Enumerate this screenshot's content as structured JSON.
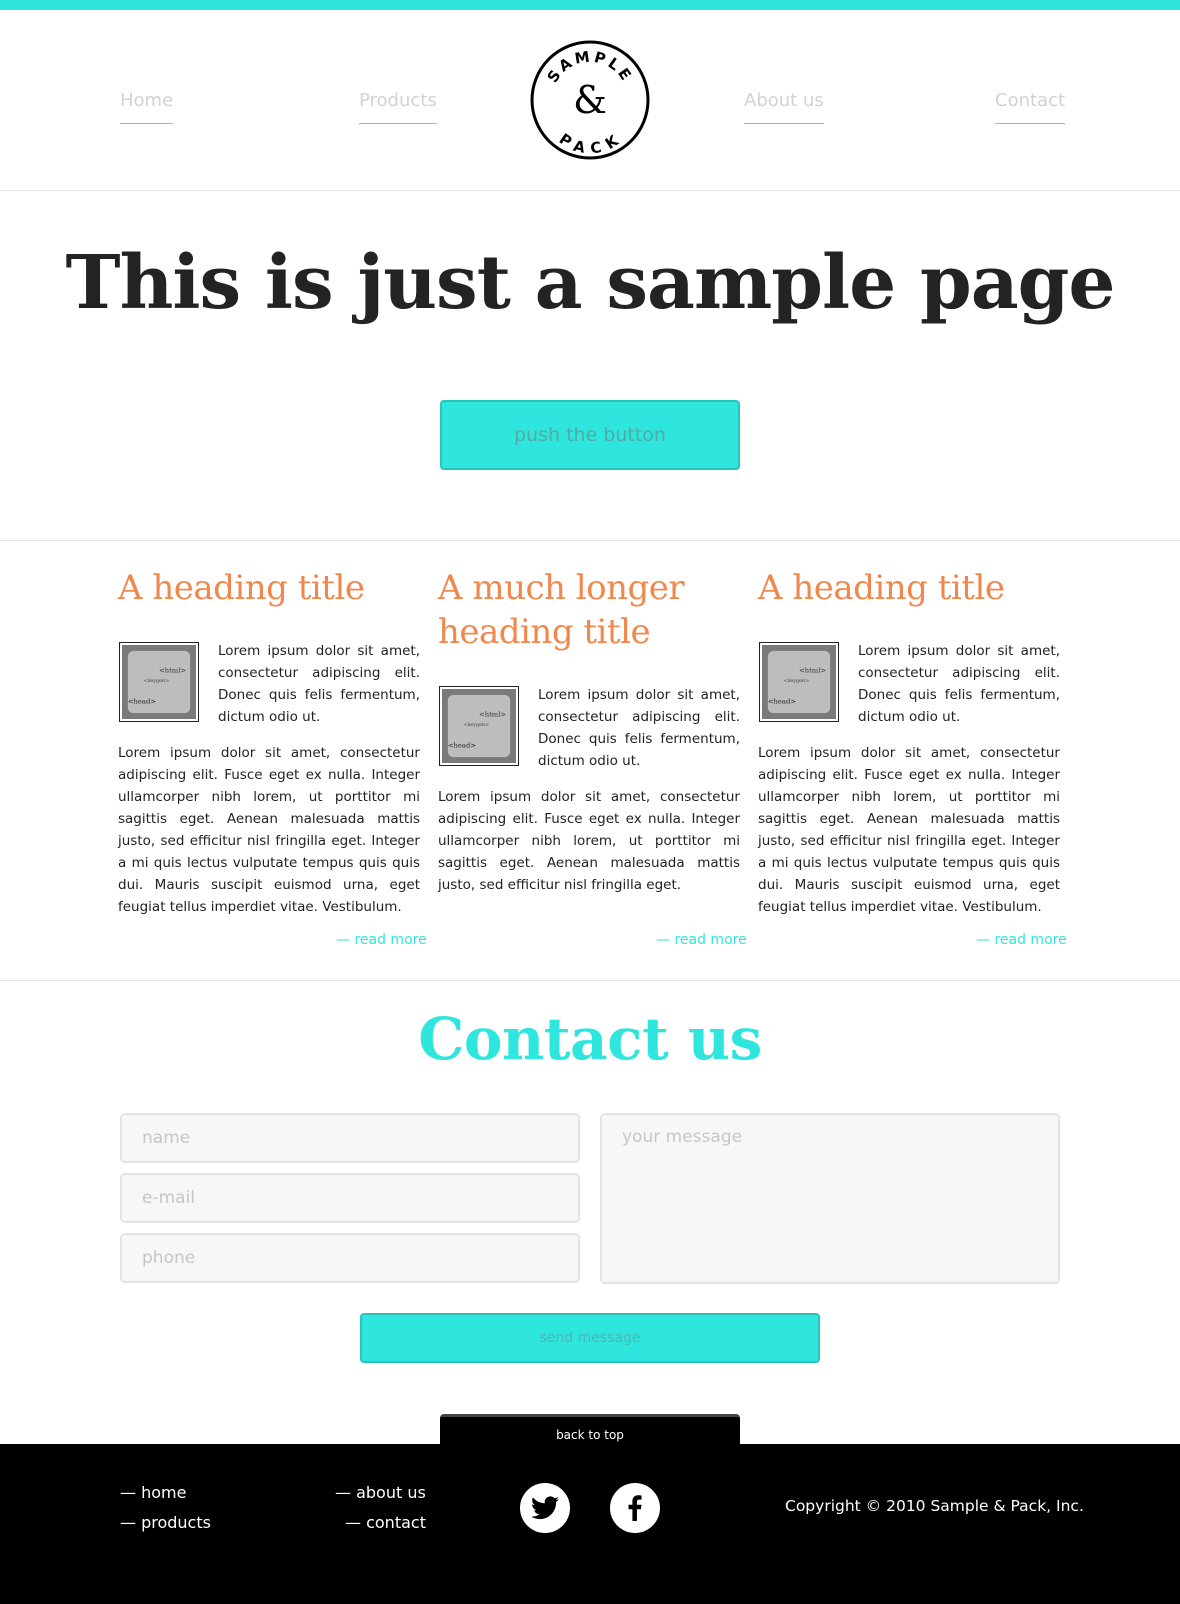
{
  "colors": {
    "accent": "#2ee6dd",
    "heading": "#f0884d",
    "footer": "#000000"
  },
  "nav": {
    "home": "Home",
    "products": "Products",
    "about": "About us",
    "contact": "Contact"
  },
  "logo": {
    "top": "SAMPLE",
    "middle": "&",
    "bottom": "PACK"
  },
  "hero": {
    "title": "This is just a sample page",
    "button": "push the button"
  },
  "columns": [
    {
      "heading": "A heading title",
      "intro": "Lorem ipsum dolor sit amet, consectetur adipiscing elit. Donec quis felis fermentum, dictum odio ut.",
      "body": "Lorem ipsum dolor sit amet, consectetur adip­iscing elit. Fusce eget ex nulla. Integer ullam­corper nibh lorem, ut porttitor mi sagittis eget. Aenean malesuada mattis justo, sed efficitur nisl fringilla eget. Integer a mi quis lectus vul­putate tempus quis quis dui. Mauris suscipit euismod urna, eget feugiat tellus imperdiet vitae. Vestibulum.",
      "read_more": "— read more"
    },
    {
      "heading": "A much longer heading title",
      "intro": "Lorem ipsum dolor sit amet, consectetur adipiscing elit. Donec quis felis fermentum, dictum odio ut.",
      "body": "Lorem ipsum dolor sit amet, consectetur adip­iscing elit. Fusce eget ex nulla. Integer ullam­corper nibh lorem, ut porttitor mi sagittis eget. Aenean malesuada mattis justo, sed efficitur nisl fringilla eget.",
      "read_more": "— read more"
    },
    {
      "heading": "A heading title",
      "intro": "Lorem ipsum dolor sit amet, consectetur adipiscing elit. Donec quis felis fermentum, dictum odio ut.",
      "body": "Lorem ipsum dolor sit amet, consectetur adip­iscing elit. Fusce eget ex nulla. Integer ullam­corper nibh lorem, ut porttitor mi sagittis eget. Aenean malesuada mattis justo, sed efficitur nisl fringilla eget. Integer a mi quis lectus vul­putate tempus quis quis dui. Mauris suscipit euismod urna, eget feugiat tellus imperdiet vitae. Vestibulum.",
      "read_more": "— read more"
    }
  ],
  "contact": {
    "title": "Contact us",
    "name_placeholder": "name",
    "email_placeholder": "e-mail",
    "phone_placeholder": "phone",
    "message_placeholder": "your message",
    "send": "send message"
  },
  "footer": {
    "back_to_top": "back to top",
    "home": "— home",
    "products": "— products",
    "about": "— about us",
    "contact": "— contact",
    "copyright": "Copyright © 2010 Sample & Pack, Inc.",
    "social": [
      "twitter-icon",
      "facebook-icon"
    ]
  }
}
